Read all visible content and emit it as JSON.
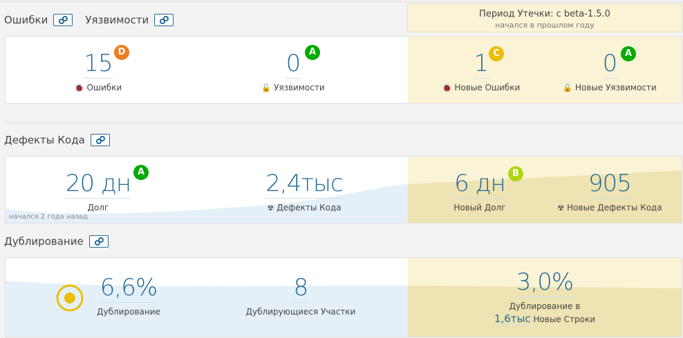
{
  "sections": {
    "bugs": "Ошибки",
    "vulns": "Уязвимости",
    "debt": "Дефекты Кода",
    "dup": "Дублирование"
  },
  "period": {
    "title": "Период Утечки: с beta-1.5.0",
    "subtitle": "начался в прошлом году"
  },
  "row1": [
    {
      "value": "15",
      "rating": "D",
      "label": "Ошибки"
    },
    {
      "value": "0",
      "rating": "A",
      "label": "Уязвимости"
    },
    {
      "value": "1",
      "rating": "C",
      "label": "Новые Ошибки"
    },
    {
      "value": "0",
      "rating": "A",
      "label": "Новые Уязвимости"
    }
  ],
  "row2": [
    {
      "value": "20 дн",
      "rating": "A",
      "label": "Долг"
    },
    {
      "value": "2,4тыс",
      "label": "Дефекты Кода"
    },
    {
      "value": "6 дн",
      "rating": "B",
      "label": "Новый Долг"
    },
    {
      "value": "905",
      "label": "Новые Дефекты Кода"
    }
  ],
  "row2_note": "начался 2 года назад",
  "row3": {
    "dup": "6,6%",
    "dup_label": "Дублирование",
    "blocks": "8",
    "blocks_label": "Дублирующиеся Участки",
    "new_dup": "3,0%",
    "new_dup_label": "Дублирование в",
    "new_lines": "1,6тыс",
    "new_lines_label": "Новые Строки"
  },
  "colors": {
    "A": "#00aa00",
    "B": "#b0d513",
    "C": "#eabe06",
    "D": "#ed7d20",
    "link": "#236a97"
  }
}
